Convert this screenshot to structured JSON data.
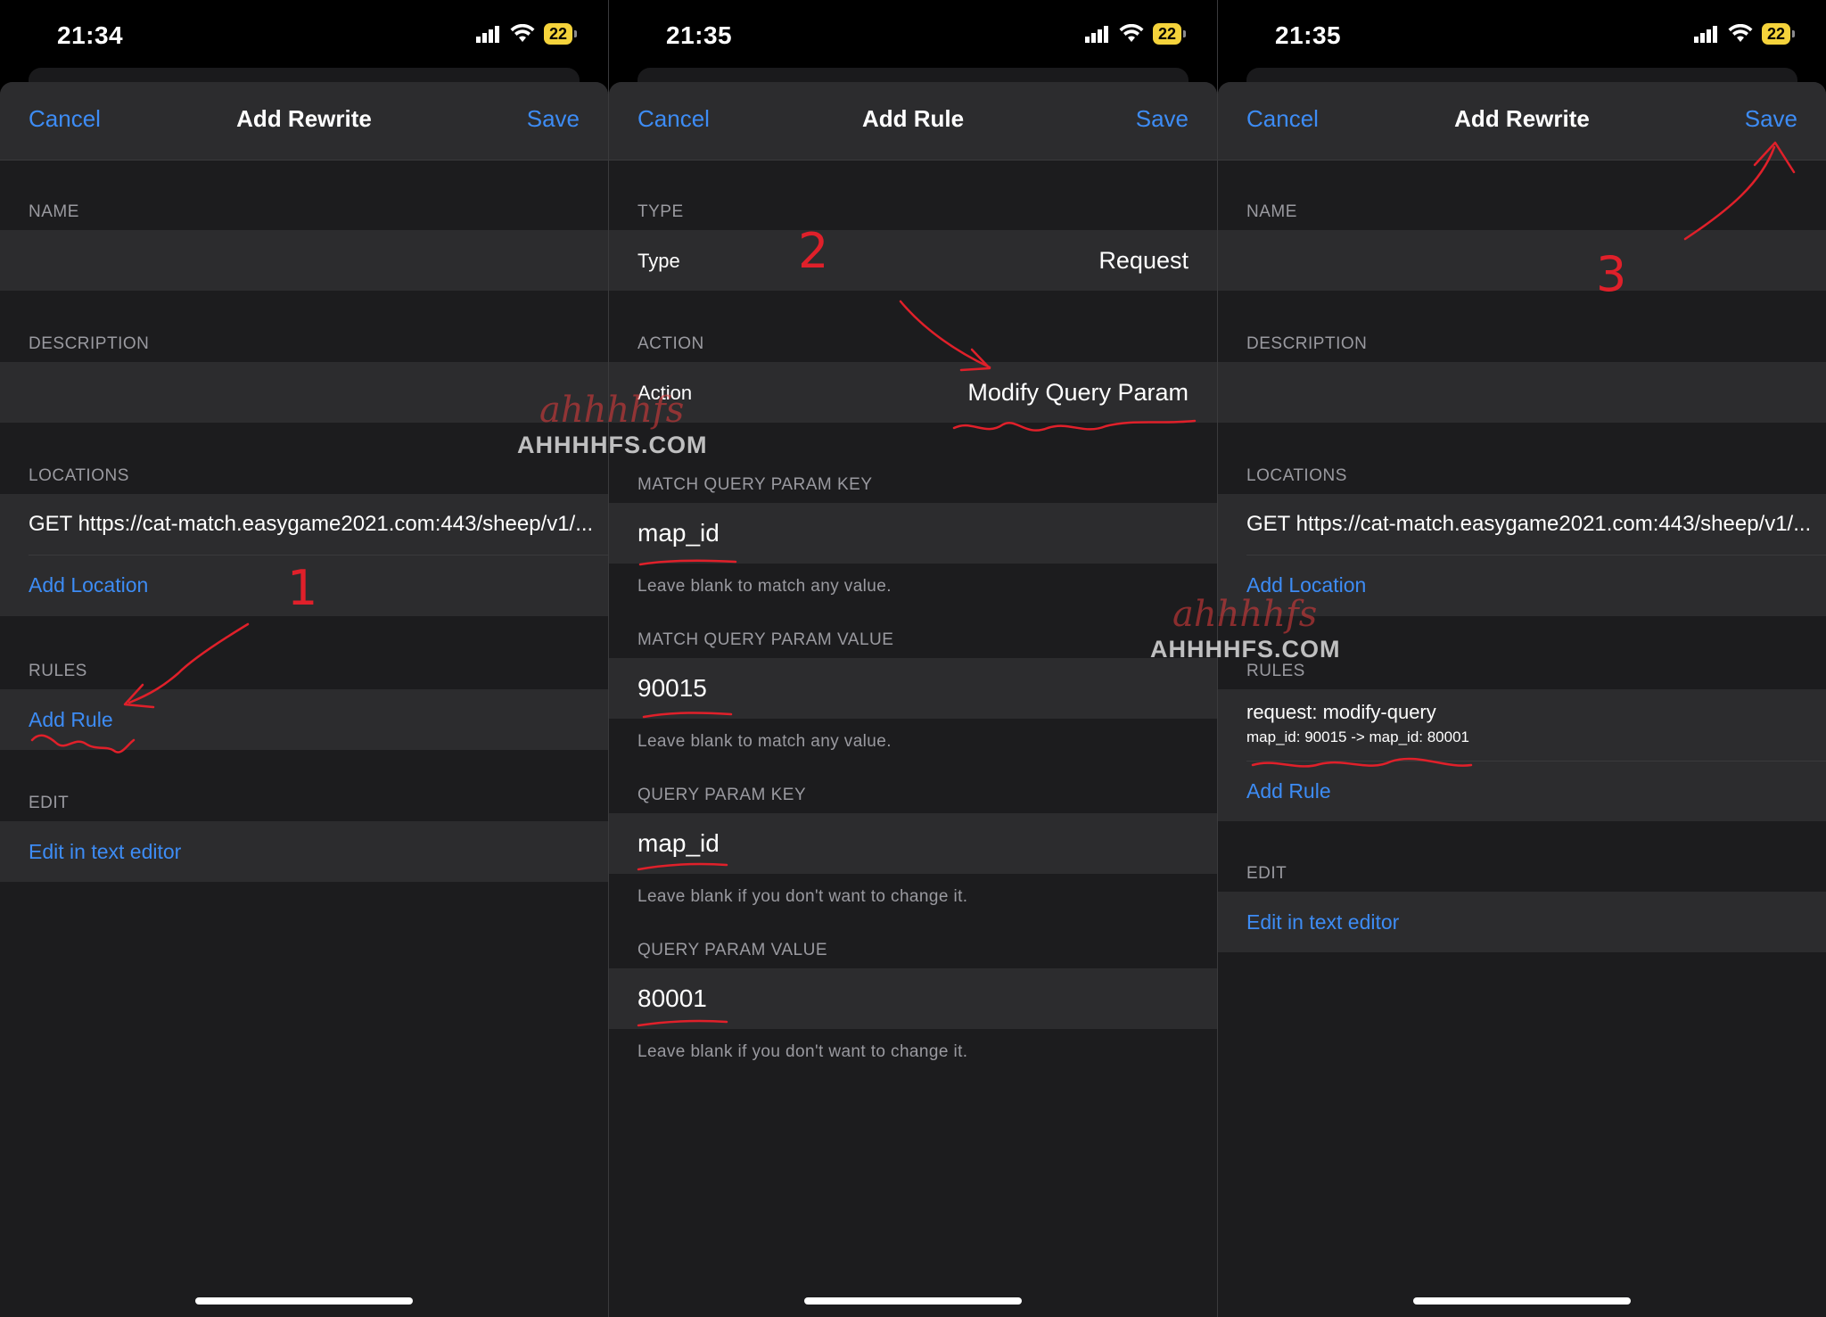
{
  "colors": {
    "accent": "#3d8cf5",
    "annotation": "#e0202a",
    "battery": "#f5d33b"
  },
  "icons": [
    "signal-icon",
    "wifi-icon",
    "battery-icon"
  ],
  "watermark": {
    "site": "AHHHHFS.COM",
    "logo": "ahhhhfs"
  },
  "screen1": {
    "status": {
      "time": "21:34",
      "battery": "22"
    },
    "nav": {
      "cancel": "Cancel",
      "title": "Add Rewrite",
      "save": "Save"
    },
    "sections": {
      "name": "NAME",
      "description": "DESCRIPTION",
      "locations": "LOCATIONS",
      "rules": "RULES",
      "edit": "EDIT"
    },
    "location_value": "GET https://cat-match.easygame2021.com:443/sheep/v1/...",
    "add_location": "Add Location",
    "add_rule": "Add Rule",
    "edit_text_editor": "Edit in text editor",
    "annotation_number": "1"
  },
  "screen2": {
    "status": {
      "time": "21:35",
      "battery": "22"
    },
    "nav": {
      "cancel": "Cancel",
      "title": "Add Rule",
      "save": "Save"
    },
    "type_section": "TYPE",
    "type_label": "Type",
    "type_value": "Request",
    "action_section": "ACTION",
    "action_label": "Action",
    "action_value": "Modify Query Param",
    "match_key_section": "MATCH QUERY PARAM KEY",
    "match_key_value": "map_id",
    "match_key_hint": "Leave blank to match any value.",
    "match_value_section": "MATCH QUERY PARAM VALUE",
    "match_value_value": "90015",
    "match_value_hint": "Leave blank to match any value.",
    "key_section": "QUERY PARAM KEY",
    "key_value": "map_id",
    "key_hint": "Leave blank if you don't want to change it.",
    "value_section": "QUERY PARAM VALUE",
    "value_value": "80001",
    "value_hint": "Leave blank if you don't want to change it.",
    "annotation_number": "2"
  },
  "screen3": {
    "status": {
      "time": "21:35",
      "battery": "22"
    },
    "nav": {
      "cancel": "Cancel",
      "title": "Add Rewrite",
      "save": "Save"
    },
    "sections": {
      "name": "NAME",
      "description": "DESCRIPTION",
      "locations": "LOCATIONS",
      "rules": "RULES",
      "edit": "EDIT"
    },
    "location_value": "GET https://cat-match.easygame2021.com:443/sheep/v1/...",
    "add_location": "Add Location",
    "rule_title": "request: modify-query",
    "rule_detail": "map_id: 90015 -> map_id: 80001",
    "add_rule": "Add Rule",
    "edit_text_editor": "Edit in text editor",
    "annotation_number": "3"
  }
}
